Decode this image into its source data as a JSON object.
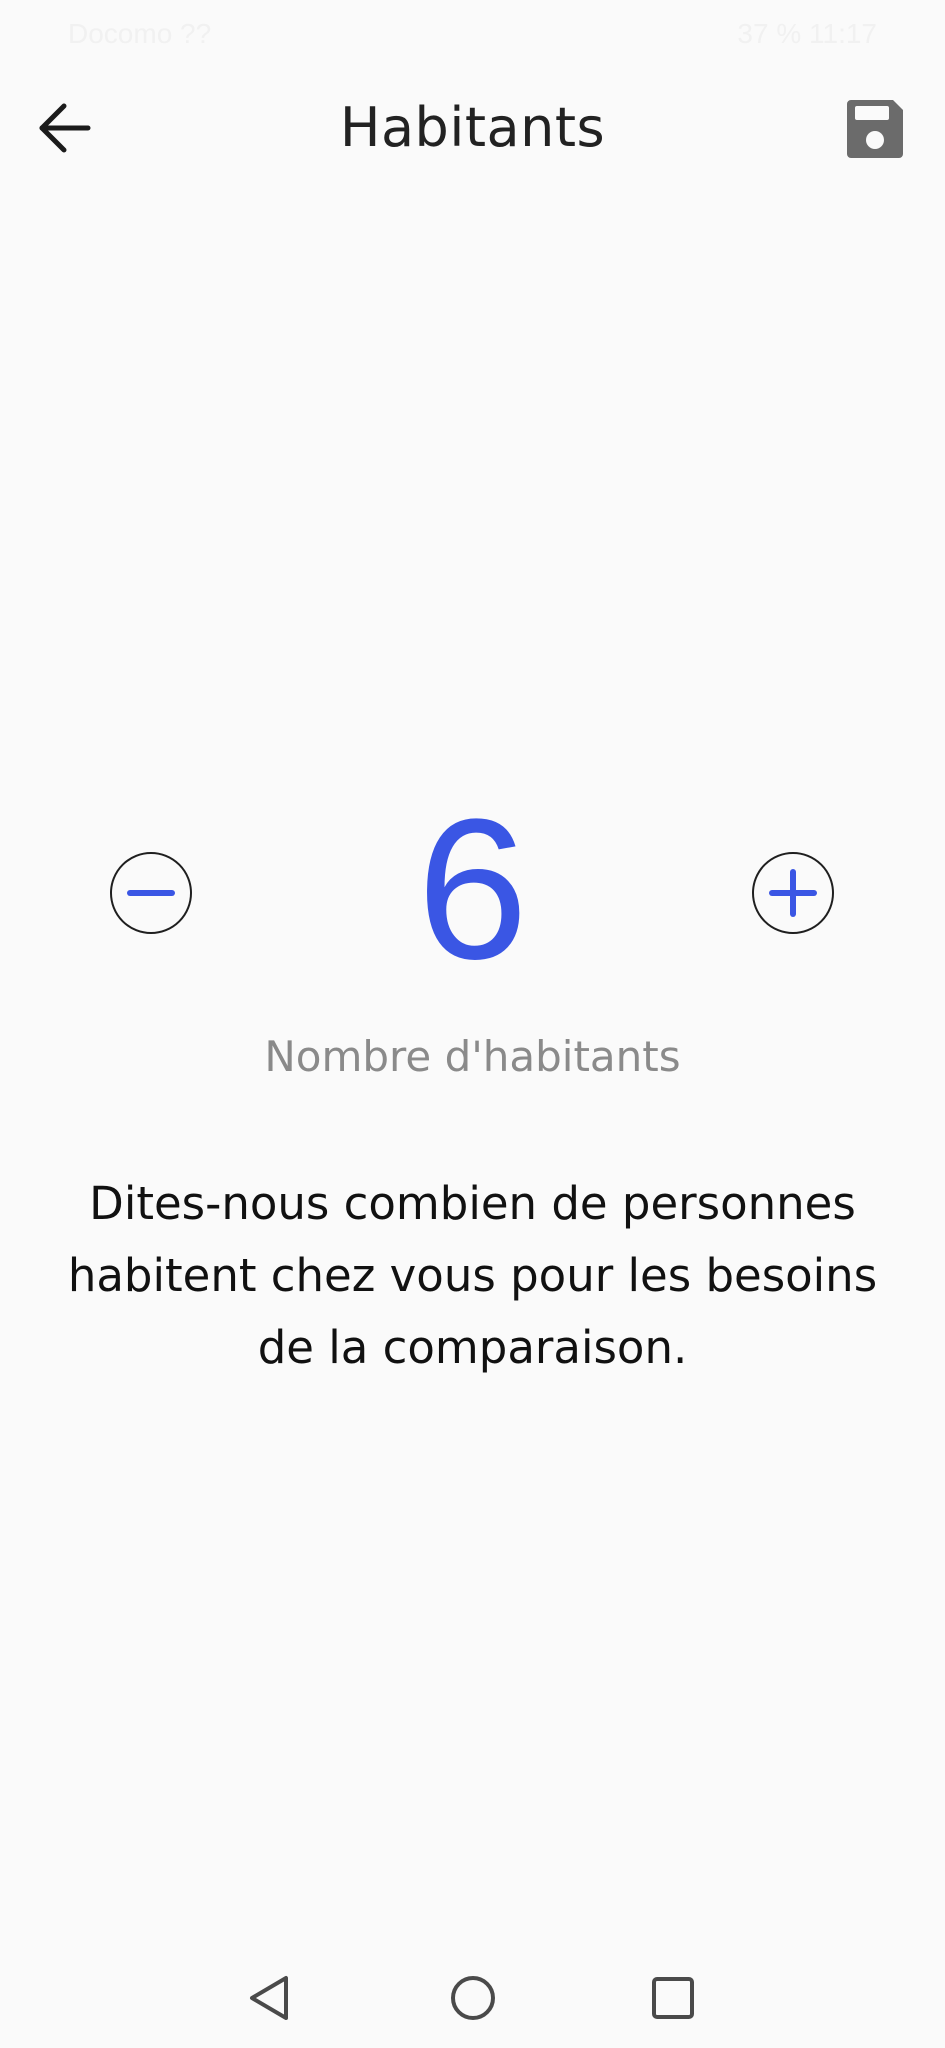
{
  "status_bar": {
    "carrier": "Docomo ??",
    "right": "37 % 11:17"
  },
  "header": {
    "title": "Habitants",
    "back_icon": "arrow-left-icon",
    "save_icon": "floppy-disk-icon"
  },
  "stepper": {
    "value": "6",
    "label": "Nombre d'habitants",
    "minus_icon": "minus-circle-icon",
    "plus_icon": "plus-circle-icon"
  },
  "description": "Dites-nous combien de personnes habitent chez vous pour les besoins de la comparaison.",
  "colors": {
    "accent": "#3a56e4",
    "background": "#fafafa",
    "text": "#111111",
    "muted": "#8a8a8a",
    "icon_gray": "#6b6b6b"
  },
  "nav": {
    "back_icon": "triangle-back-icon",
    "home_icon": "circle-home-icon",
    "recent_icon": "square-recents-icon"
  }
}
